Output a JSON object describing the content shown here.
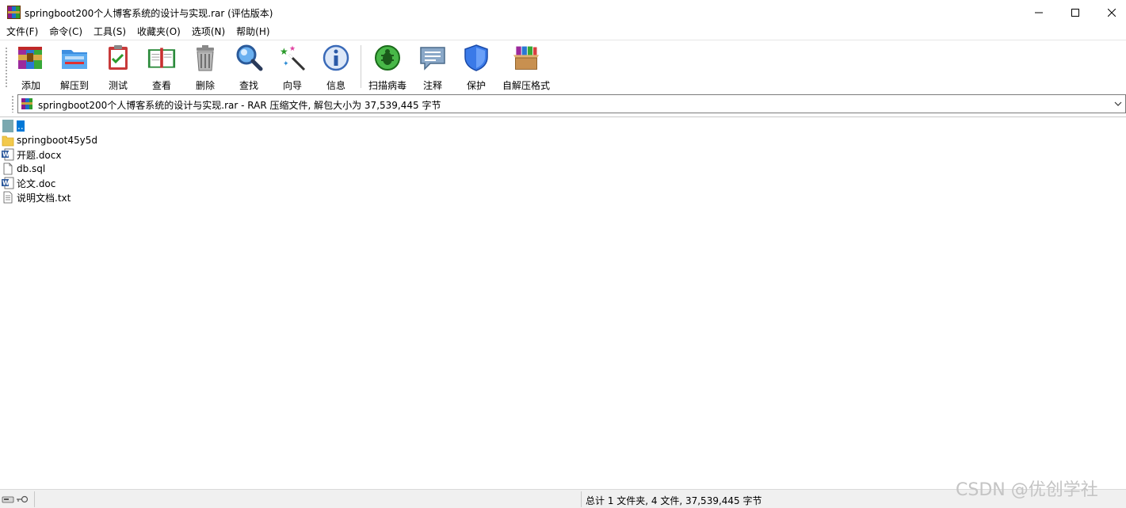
{
  "window": {
    "title": "springboot200个人博客系统的设计与实现.rar (评估版本)"
  },
  "menu": [
    {
      "label": "文件(F)"
    },
    {
      "label": "命令(C)"
    },
    {
      "label": "工具(S)"
    },
    {
      "label": "收藏夹(O)"
    },
    {
      "label": "选项(N)"
    },
    {
      "label": "帮助(H)"
    }
  ],
  "toolbar": {
    "buttons": [
      {
        "label": "添加",
        "icon": "add-archive-icon"
      },
      {
        "label": "解压到",
        "icon": "extract-folder-icon"
      },
      {
        "label": "测试",
        "icon": "test-clipboard-icon"
      },
      {
        "label": "查看",
        "icon": "view-book-icon"
      },
      {
        "label": "删除",
        "icon": "trash-icon"
      },
      {
        "label": "查找",
        "icon": "magnifier-icon"
      },
      {
        "label": "向导",
        "icon": "wizard-wand-icon"
      },
      {
        "label": "信息",
        "icon": "info-icon"
      },
      {
        "label": "扫描病毒",
        "icon": "virus-scan-icon"
      },
      {
        "label": "注释",
        "icon": "comment-icon"
      },
      {
        "label": "保护",
        "icon": "shield-icon"
      },
      {
        "label": "自解压格式",
        "icon": "sfx-box-icon"
      }
    ]
  },
  "address": {
    "text": "springboot200个人博客系统的设计与实现.rar - RAR 压缩文件, 解包大小为 37,539,445 字节"
  },
  "files": [
    {
      "name": "..",
      "type": "parent",
      "selected": true
    },
    {
      "name": "springboot45y5d",
      "type": "folder"
    },
    {
      "name": "开题.docx",
      "type": "word"
    },
    {
      "name": "db.sql",
      "type": "file"
    },
    {
      "name": "论文.doc",
      "type": "word"
    },
    {
      "name": "说明文档.txt",
      "type": "text"
    }
  ],
  "status": {
    "summary": "总计 1 文件夹, 4 文件, 37,539,445 字节"
  },
  "watermark": "CSDN @优创学社"
}
